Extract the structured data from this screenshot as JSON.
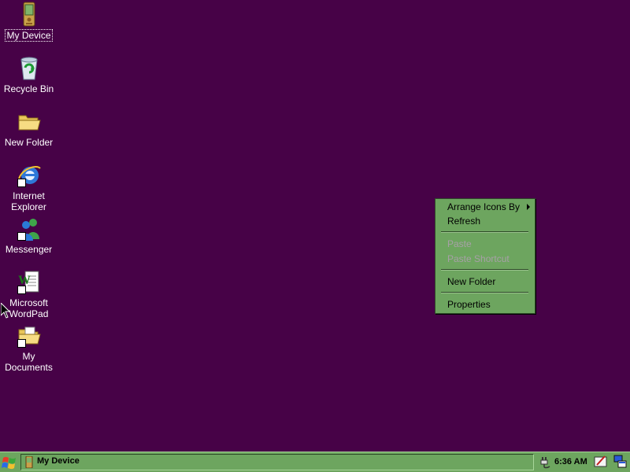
{
  "desktop": {
    "background_color": "#470247",
    "icons": [
      {
        "label": "My Device",
        "icon": "pda-icon",
        "selected": true
      },
      {
        "label": "Recycle Bin",
        "icon": "recycle-bin-icon"
      },
      {
        "label": "New Folder",
        "icon": "folder-icon"
      },
      {
        "label": "Internet Explorer",
        "icon": "internet-explorer-icon",
        "shortcut": true
      },
      {
        "label": "Messenger",
        "icon": "messenger-icon",
        "shortcut": true
      },
      {
        "label": "Microsoft WordPad",
        "icon": "wordpad-icon",
        "shortcut": true
      },
      {
        "label": "My Documents",
        "icon": "folder-icon",
        "shortcut": true
      }
    ]
  },
  "context_menu": {
    "background_color": "#6da55f",
    "items": [
      {
        "label": "Arrange Icons By",
        "enabled": true,
        "submenu": true
      },
      {
        "label": "Refresh",
        "enabled": true
      },
      {
        "label": "Paste",
        "enabled": false
      },
      {
        "label": "Paste Shortcut",
        "enabled": false
      },
      {
        "label": "New Folder",
        "enabled": true
      },
      {
        "label": "Properties",
        "enabled": true
      }
    ]
  },
  "taskbar": {
    "background_color": "#6da55f",
    "start_icon": "windows-flag-icon",
    "active_task": {
      "label": "My Device",
      "icon": "pda-icon"
    },
    "tray": {
      "time": "6:36 AM",
      "icons": [
        "connection-plug-icon",
        "pen-input-icon",
        "desktop-switch-icon"
      ]
    }
  }
}
